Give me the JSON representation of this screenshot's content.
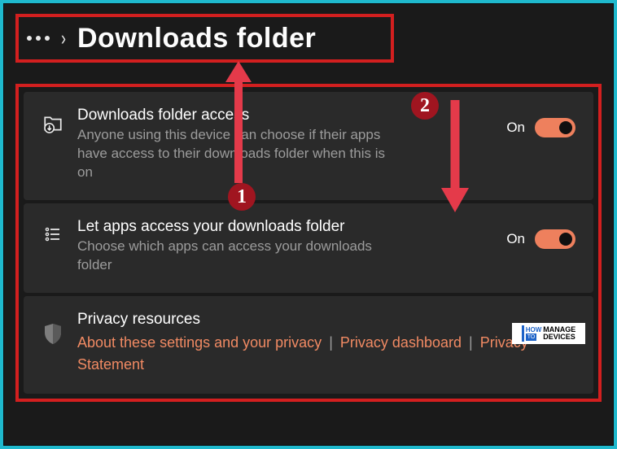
{
  "breadcrumb": {
    "title": "Downloads folder"
  },
  "settings": [
    {
      "title": "Downloads folder access",
      "description": "Anyone using this device can choose if their apps have access to their downloads folder when this is on",
      "state_label": "On",
      "state": true
    },
    {
      "title": "Let apps access your downloads folder",
      "description": "Choose which apps can access your downloads folder",
      "state_label": "On",
      "state": true
    }
  ],
  "privacy": {
    "title": "Privacy resources",
    "links": [
      "About these settings and your privacy",
      "Privacy dashboard",
      "Privacy Statement"
    ]
  },
  "annotations": {
    "badge1": "1",
    "badge2": "2",
    "watermark": {
      "how": "HOW",
      "to": "TO",
      "manage": "MANAGE",
      "devices": "DEVICES"
    }
  },
  "colors": {
    "accent": "#ee805d",
    "annotation_red": "#d31f1f"
  }
}
